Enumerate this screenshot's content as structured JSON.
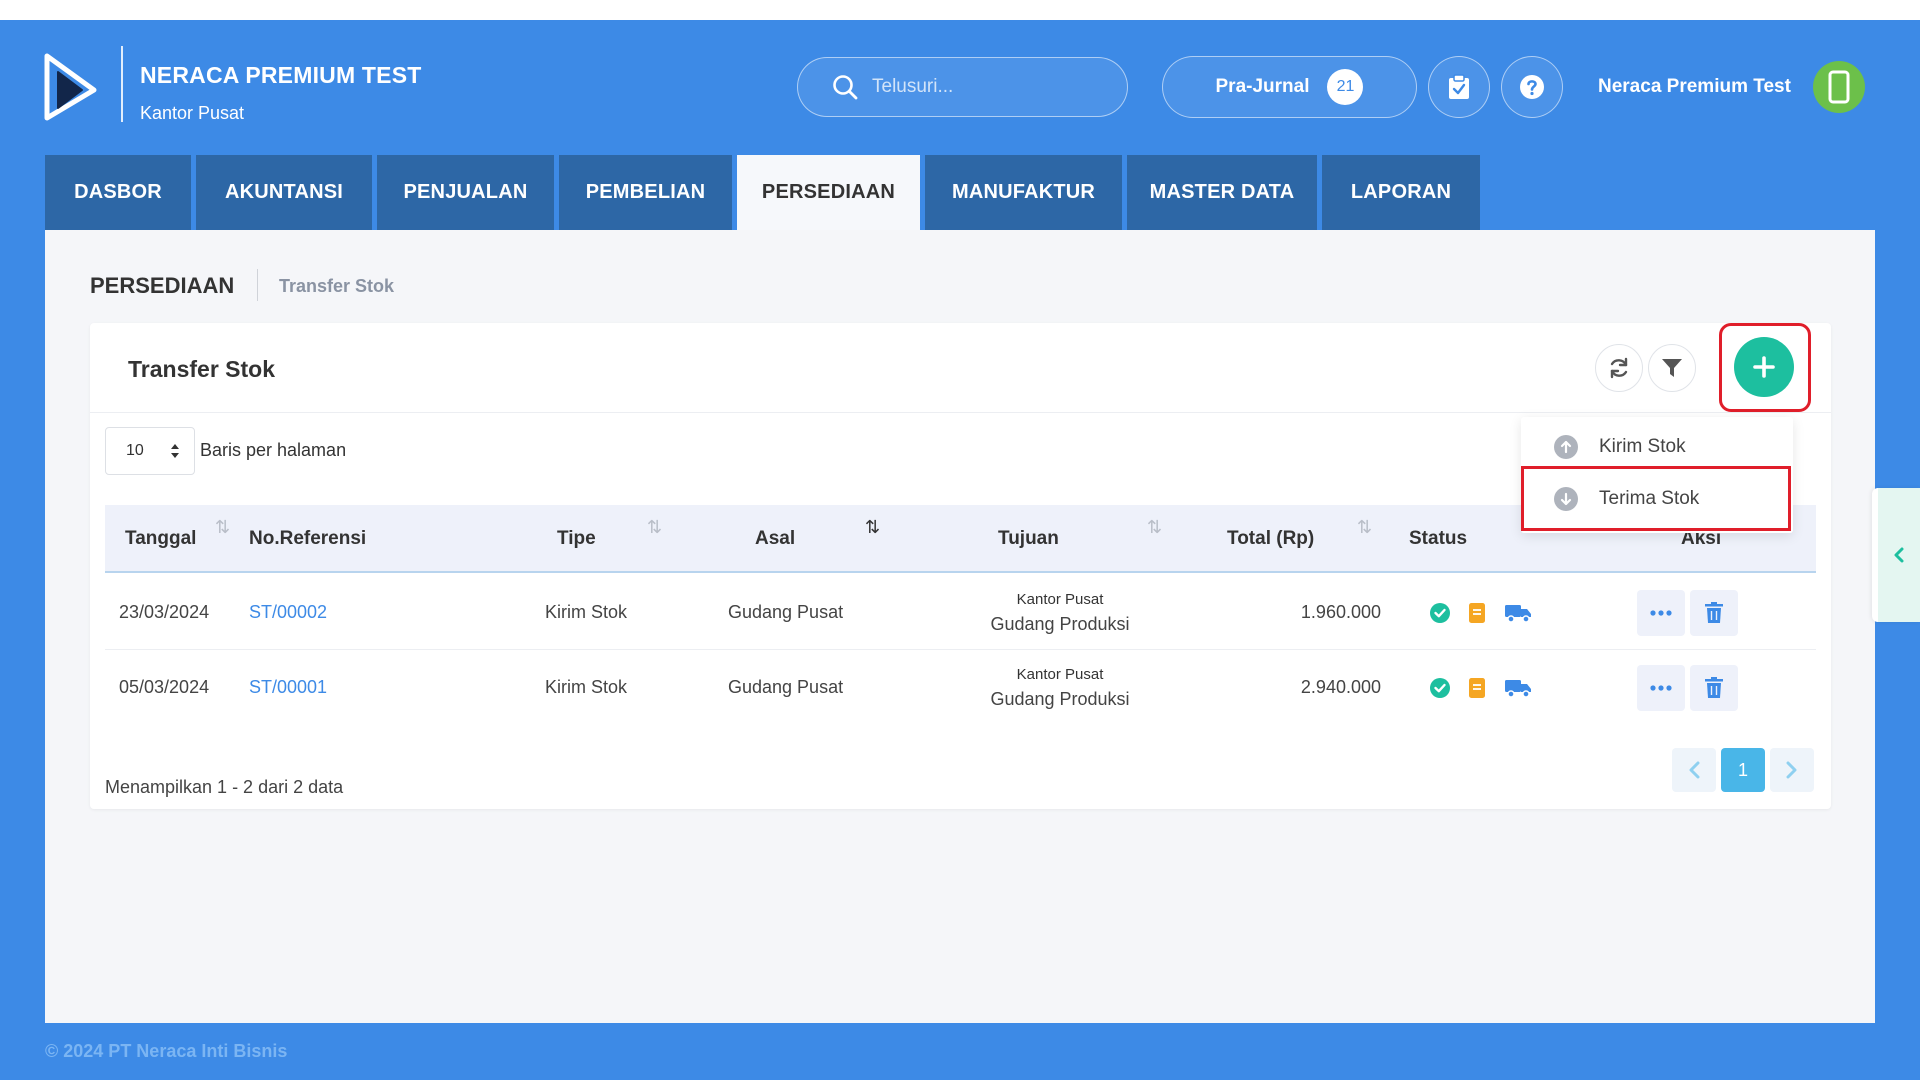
{
  "header": {
    "company": "NERACA PREMIUM TEST",
    "branch": "Kantor Pusat",
    "search_placeholder": "Telusuri...",
    "prajurnal_label": "Pra-Jurnal",
    "prajurnal_count": "21",
    "user_name": "Neraca Premium Test"
  },
  "nav": {
    "tabs": [
      "DASBOR",
      "AKUNTANSI",
      "PENJUALAN",
      "PEMBELIAN",
      "PERSEDIAAN",
      "MANUFAKTUR",
      "MASTER DATA",
      "LAPORAN"
    ],
    "active": "PERSEDIAAN"
  },
  "breadcrumb": {
    "section": "PERSEDIAAN",
    "page": "Transfer Stok"
  },
  "card": {
    "title": "Transfer Stok",
    "rows_per_page_value": "10",
    "rows_per_page_label": "Baris per halaman"
  },
  "table": {
    "columns": [
      "Tanggal",
      "No.Referensi",
      "Tipe",
      "Asal",
      "Tujuan",
      "Total (Rp)",
      "Status",
      "Aksi"
    ],
    "rows": [
      {
        "date": "23/03/2024",
        "ref": "ST/00002",
        "type": "Kirim Stok",
        "origin": "Gudang Pusat",
        "dest_branch": "Kantor Pusat",
        "dest_warehouse": "Gudang Produksi",
        "total": "1.960.000"
      },
      {
        "date": "05/03/2024",
        "ref": "ST/00001",
        "type": "Kirim Stok",
        "origin": "Gudang Pusat",
        "dest_branch": "Kantor Pusat",
        "dest_warehouse": "Gudang Produksi",
        "total": "2.940.000"
      }
    ]
  },
  "footer": {
    "info": "Menampilkan 1 - 2 dari 2 data",
    "current_page": "1"
  },
  "dropdown": {
    "items": [
      "Kirim Stok",
      "Terima Stok"
    ]
  },
  "copyright": "© 2024 PT Neraca Inti Bisnis",
  "colors": {
    "primary": "#3d8ae6",
    "nav_tab": "#2d67a6",
    "add_button": "#1dbf9f",
    "highlight": "#e01e2a",
    "status_ok": "#1dbf9f",
    "status_doc": "#f5a623",
    "status_truck": "#3d8ae6"
  }
}
